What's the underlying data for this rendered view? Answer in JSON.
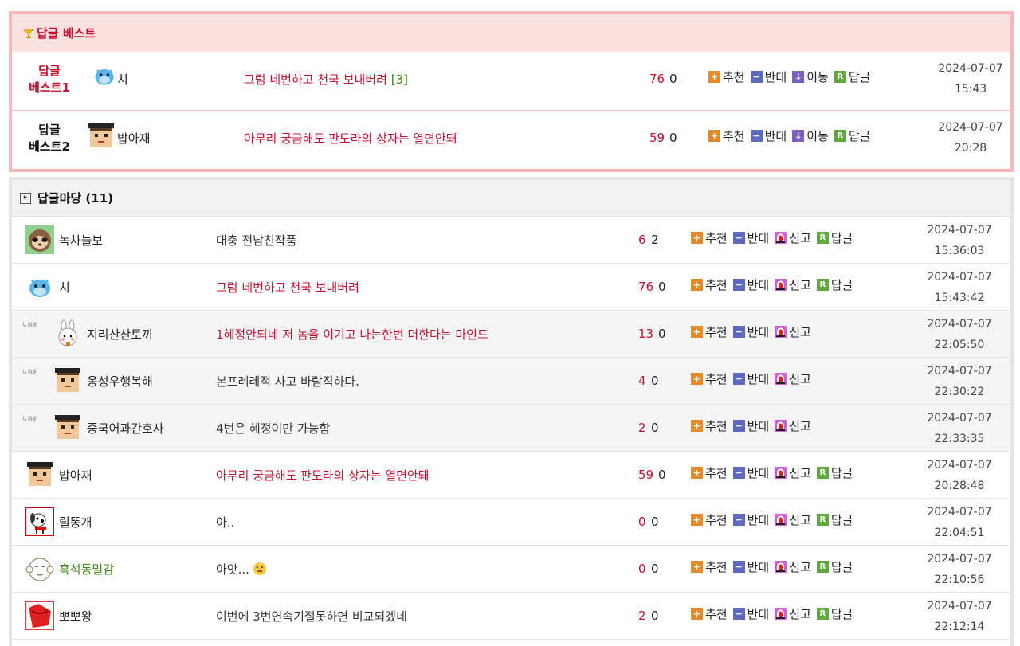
{
  "best": {
    "title": "답글 베스트",
    "rows": [
      {
        "rank_l1": "답글",
        "rank_l2": "베스트1",
        "nick": "치",
        "content": "그럼 네번하고 천국 보내버려",
        "count": "[3]",
        "up": "76",
        "down": "0",
        "date": "2024-07-07",
        "time": "15:43",
        "avatar": "blue-bird-icon"
      },
      {
        "rank_l1": "답글",
        "rank_l2": "베스트2",
        "nick": "밥아재",
        "content": "아무리 궁금해도 판도라의 상자는 열면안돼",
        "count": "",
        "up": "59",
        "down": "0",
        "date": "2024-07-07",
        "time": "20:28",
        "avatar": "pixel-man-icon"
      }
    ],
    "actions": {
      "recommend": "추천",
      "oppose": "반대",
      "move": "이동",
      "reply": "답글"
    }
  },
  "replies": {
    "title": "답글마당 (11)",
    "actions": {
      "recommend": "추천",
      "oppose": "반대",
      "report": "신고",
      "reply": "답글"
    },
    "re_label": "RE",
    "rows": [
      {
        "nick": "녹차늘보",
        "content": "대충 전남친작품",
        "red": false,
        "up": "6",
        "down": "2",
        "date": "2024-07-07",
        "time": "15:36:03",
        "re": false,
        "reply_btn": true,
        "avatar": "sloth-icon"
      },
      {
        "nick": "치",
        "content": "그럼 네번하고 천국 보내버려",
        "red": true,
        "up": "76",
        "down": "0",
        "date": "2024-07-07",
        "time": "15:43:42",
        "re": false,
        "reply_btn": true,
        "avatar": "blue-bird-icon"
      },
      {
        "nick": "지리산산토끼",
        "content": "1혜정안되네 저 놈을 이기고 나는한번 더한다는 마인드",
        "red": true,
        "up": "13",
        "down": "0",
        "date": "2024-07-07",
        "time": "22:05:50",
        "re": true,
        "reply_btn": false,
        "avatar": "rabbit-icon"
      },
      {
        "nick": "옹성우행복해",
        "content": "본프레레적 사고 바람직하다.",
        "red": false,
        "up": "4",
        "down": "0",
        "date": "2024-07-07",
        "time": "22:30:22",
        "re": true,
        "reply_btn": false,
        "avatar": "pixel-man-icon"
      },
      {
        "nick": "중국어과간호사",
        "content": "4번은 혜정이만 가능함",
        "red": false,
        "up": "2",
        "down": "0",
        "date": "2024-07-07",
        "time": "22:33:35",
        "re": true,
        "reply_btn": false,
        "avatar": "pixel-man-icon"
      },
      {
        "nick": "밥아재",
        "content": "아무리 궁금해도 판도라의 상자는 열면안돼",
        "red": true,
        "up": "59",
        "down": "0",
        "date": "2024-07-07",
        "time": "20:28:48",
        "re": false,
        "reply_btn": true,
        "avatar": "pixel-man-icon"
      },
      {
        "nick": "릴똥개",
        "content": "아..",
        "red": false,
        "up": "0",
        "down": "0",
        "date": "2024-07-07",
        "time": "22:04:51",
        "re": false,
        "reply_btn": true,
        "avatar": "dog-icon"
      },
      {
        "nick": "흑석동밀감",
        "content": "아앗...",
        "red": false,
        "up": "0",
        "down": "0",
        "date": "2024-07-07",
        "time": "22:10:56",
        "re": false,
        "reply_btn": true,
        "avatar": "monkey-icon",
        "nick_green": true,
        "emoji": true
      },
      {
        "nick": "뽀뽀왕",
        "content": "이번에 3번연속기절못하면 비교되겠네",
        "red": false,
        "up": "2",
        "down": "0",
        "date": "2024-07-07",
        "time": "22:12:14",
        "re": false,
        "reply_btn": true,
        "avatar": "red-bag-icon"
      }
    ]
  }
}
